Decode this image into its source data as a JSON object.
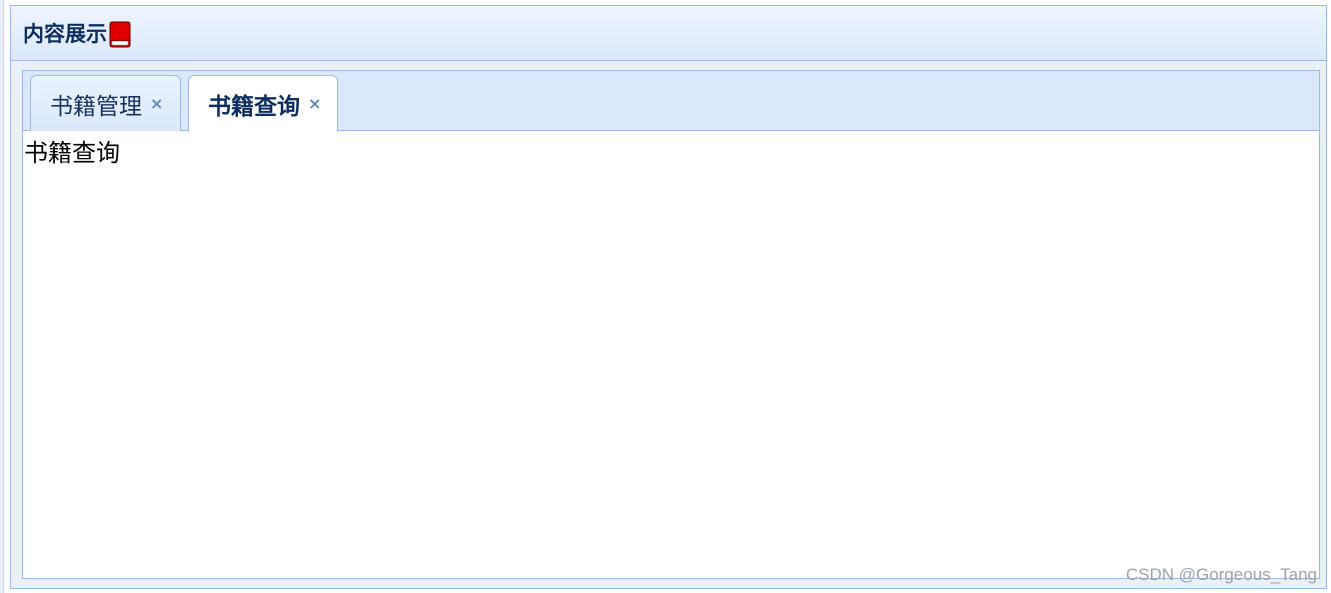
{
  "panel": {
    "title": "内容展示",
    "title_icon": "book-icon"
  },
  "tabs": [
    {
      "label": "书籍管理",
      "close": "×",
      "active": false
    },
    {
      "label": "书籍查询",
      "close": "×",
      "active": true
    }
  ],
  "content": {
    "text": "书籍查询"
  },
  "watermark": "CSDN @Gorgeous_Tang",
  "colors": {
    "title": "#0e2d5f",
    "border": "#99bbe8",
    "tab_strip": "#dbe8fb",
    "close": "#5d86c0",
    "book": "#e00000"
  }
}
